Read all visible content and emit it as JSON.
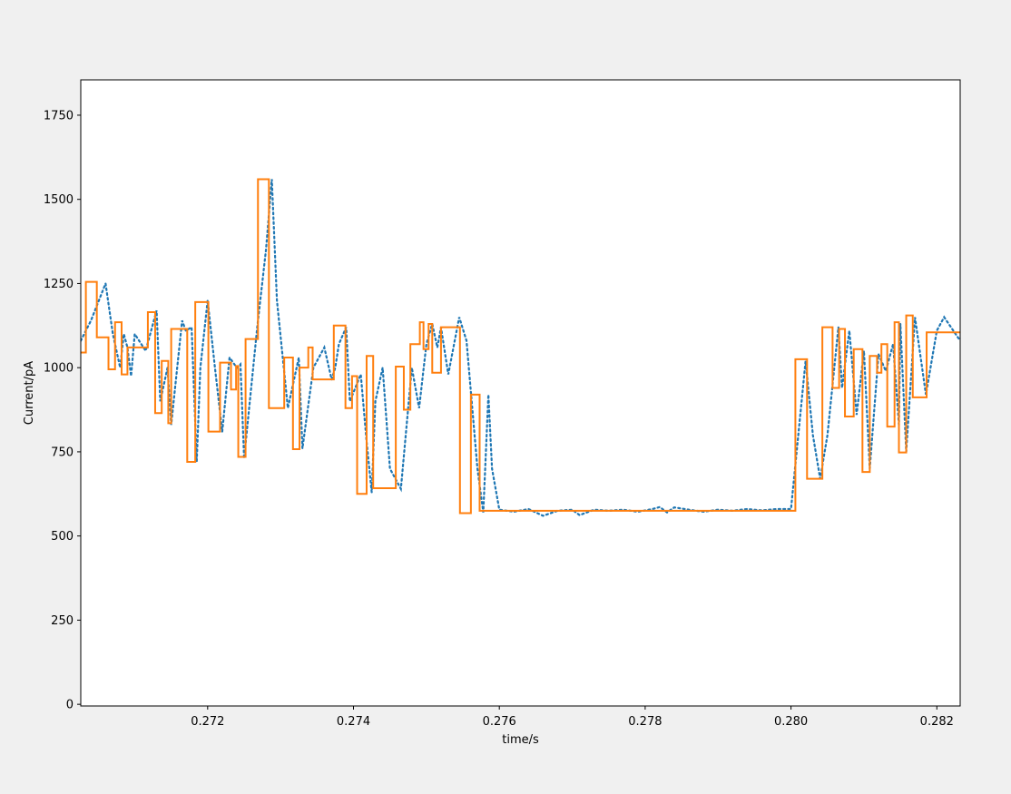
{
  "chart_data": {
    "type": "line",
    "title": "",
    "xlabel": "time/s",
    "ylabel": "Current/pA",
    "xlim": [
      0.27026,
      0.28232
    ],
    "ylim": [
      -5,
      1855
    ],
    "grid": false,
    "x_ticks": [
      {
        "value": 0.272,
        "label": "0.272"
      },
      {
        "value": 0.274,
        "label": "0.274"
      },
      {
        "value": 0.276,
        "label": "0.276"
      },
      {
        "value": 0.278,
        "label": "0.278"
      },
      {
        "value": 0.28,
        "label": "0.280"
      },
      {
        "value": 0.282,
        "label": "0.282"
      }
    ],
    "y_ticks": [
      {
        "value": 0,
        "label": "0"
      },
      {
        "value": 250,
        "label": "250"
      },
      {
        "value": 500,
        "label": "500"
      },
      {
        "value": 750,
        "label": "750"
      },
      {
        "value": 1000,
        "label": "1000"
      },
      {
        "value": 1250,
        "label": "1250"
      },
      {
        "value": 1500,
        "label": "1500"
      },
      {
        "value": 1750,
        "label": "1750"
      }
    ],
    "series": [
      {
        "style": "dotted",
        "color": "#1f77b4",
        "points": [
          [
            0.27026,
            1080
          ],
          [
            0.2704,
            1140
          ],
          [
            0.2706,
            1250
          ],
          [
            0.2707,
            1100
          ],
          [
            0.2708,
            1000
          ],
          [
            0.27085,
            1100
          ],
          [
            0.2709,
            1060
          ],
          [
            0.27095,
            975
          ],
          [
            0.271,
            1100
          ],
          [
            0.27115,
            1050
          ],
          [
            0.2713,
            1170
          ],
          [
            0.27135,
            900
          ],
          [
            0.27145,
            1000
          ],
          [
            0.2715,
            830
          ],
          [
            0.27165,
            1140
          ],
          [
            0.2717,
            1110
          ],
          [
            0.27178,
            1120
          ],
          [
            0.27185,
            720
          ],
          [
            0.2719,
            1000
          ],
          [
            0.272,
            1200
          ],
          [
            0.2721,
            1000
          ],
          [
            0.2722,
            810
          ],
          [
            0.2723,
            1030
          ],
          [
            0.2724,
            1000
          ],
          [
            0.27245,
            1010
          ],
          [
            0.2725,
            730
          ],
          [
            0.27268,
            1120
          ],
          [
            0.2728,
            1350
          ],
          [
            0.27288,
            1560
          ],
          [
            0.27295,
            1200
          ],
          [
            0.2731,
            880
          ],
          [
            0.27325,
            1030
          ],
          [
            0.2733,
            760
          ],
          [
            0.27345,
            1000
          ],
          [
            0.2736,
            1060
          ],
          [
            0.2737,
            965
          ],
          [
            0.27375,
            1000
          ],
          [
            0.2738,
            1070
          ],
          [
            0.2739,
            1120
          ],
          [
            0.27395,
            900
          ],
          [
            0.2741,
            980
          ],
          [
            0.27418,
            780
          ],
          [
            0.27425,
            630
          ],
          [
            0.2743,
            900
          ],
          [
            0.2744,
            1000
          ],
          [
            0.2745,
            700
          ],
          [
            0.27465,
            640
          ],
          [
            0.2748,
            1000
          ],
          [
            0.2749,
            880
          ],
          [
            0.275,
            1070
          ],
          [
            0.27508,
            1130
          ],
          [
            0.27515,
            1060
          ],
          [
            0.2752,
            1120
          ],
          [
            0.2753,
            980
          ],
          [
            0.27545,
            1150
          ],
          [
            0.27555,
            1080
          ],
          [
            0.2757,
            700
          ],
          [
            0.27578,
            570
          ],
          [
            0.27585,
            920
          ],
          [
            0.2759,
            700
          ],
          [
            0.276,
            578
          ],
          [
            0.2762,
            572
          ],
          [
            0.2764,
            580
          ],
          [
            0.2766,
            560
          ],
          [
            0.2768,
            575
          ],
          [
            0.277,
            578
          ],
          [
            0.2771,
            562
          ],
          [
            0.2773,
            578
          ],
          [
            0.2775,
            575
          ],
          [
            0.2777,
            578
          ],
          [
            0.2779,
            572
          ],
          [
            0.2781,
            580
          ],
          [
            0.2782,
            586
          ],
          [
            0.2783,
            570
          ],
          [
            0.2784,
            585
          ],
          [
            0.2786,
            578
          ],
          [
            0.2788,
            572
          ],
          [
            0.279,
            578
          ],
          [
            0.2792,
            575
          ],
          [
            0.2794,
            580
          ],
          [
            0.2796,
            576
          ],
          [
            0.2798,
            580
          ],
          [
            0.28,
            580
          ],
          [
            0.2801,
            800
          ],
          [
            0.2802,
            1020
          ],
          [
            0.2803,
            800
          ],
          [
            0.2804,
            670
          ],
          [
            0.2805,
            800
          ],
          [
            0.28065,
            1120
          ],
          [
            0.2807,
            940
          ],
          [
            0.2808,
            1110
          ],
          [
            0.2809,
            860
          ],
          [
            0.281,
            1050
          ],
          [
            0.28108,
            700
          ],
          [
            0.2812,
            1040
          ],
          [
            0.2813,
            990
          ],
          [
            0.2814,
            1070
          ],
          [
            0.28148,
            830
          ],
          [
            0.2815,
            1130
          ],
          [
            0.28158,
            750
          ],
          [
            0.2817,
            1150
          ],
          [
            0.28185,
            920
          ],
          [
            0.282,
            1110
          ],
          [
            0.2821,
            1150
          ],
          [
            0.28232,
            1080
          ]
        ]
      },
      {
        "style": "step",
        "color": "#ff7f0e",
        "points": [
          [
            0.27026,
            1045
          ],
          [
            0.27033,
            1045
          ],
          [
            0.27033,
            1255
          ],
          [
            0.27048,
            1255
          ],
          [
            0.27048,
            1090
          ],
          [
            0.27064,
            1090
          ],
          [
            0.27064,
            995
          ],
          [
            0.27073,
            995
          ],
          [
            0.27073,
            1135
          ],
          [
            0.27082,
            1135
          ],
          [
            0.27082,
            980
          ],
          [
            0.2709,
            980
          ],
          [
            0.2709,
            1060
          ],
          [
            0.27118,
            1060
          ],
          [
            0.27118,
            1165
          ],
          [
            0.27128,
            1165
          ],
          [
            0.27128,
            865
          ],
          [
            0.27137,
            865
          ],
          [
            0.27137,
            1020
          ],
          [
            0.27146,
            1020
          ],
          [
            0.27146,
            835
          ],
          [
            0.2715,
            835
          ],
          [
            0.2715,
            1115
          ],
          [
            0.27172,
            1115
          ],
          [
            0.27172,
            720
          ],
          [
            0.27183,
            720
          ],
          [
            0.27183,
            1195
          ],
          [
            0.27201,
            1195
          ],
          [
            0.27201,
            810
          ],
          [
            0.27217,
            810
          ],
          [
            0.27217,
            1015
          ],
          [
            0.27232,
            1015
          ],
          [
            0.27232,
            935
          ],
          [
            0.27239,
            935
          ],
          [
            0.27239,
            1005
          ],
          [
            0.27242,
            1005
          ],
          [
            0.27242,
            735
          ],
          [
            0.27252,
            735
          ],
          [
            0.27252,
            1085
          ],
          [
            0.27269,
            1085
          ],
          [
            0.27269,
            1560
          ],
          [
            0.27284,
            1560
          ],
          [
            0.27284,
            880
          ],
          [
            0.27305,
            880
          ],
          [
            0.27305,
            1030
          ],
          [
            0.27317,
            1030
          ],
          [
            0.27317,
            758
          ],
          [
            0.27326,
            758
          ],
          [
            0.27326,
            1000
          ],
          [
            0.27338,
            1000
          ],
          [
            0.27338,
            1060
          ],
          [
            0.27344,
            1060
          ],
          [
            0.27344,
            965
          ],
          [
            0.27373,
            965
          ],
          [
            0.27373,
            1125
          ],
          [
            0.27389,
            1125
          ],
          [
            0.27389,
            880
          ],
          [
            0.27398,
            880
          ],
          [
            0.27398,
            975
          ],
          [
            0.27405,
            975
          ],
          [
            0.27405,
            625
          ],
          [
            0.27418,
            625
          ],
          [
            0.27418,
            1035
          ],
          [
            0.27427,
            1035
          ],
          [
            0.27427,
            642
          ],
          [
            0.27458,
            642
          ],
          [
            0.27458,
            1003
          ],
          [
            0.27469,
            1003
          ],
          [
            0.27469,
            875
          ],
          [
            0.27478,
            875
          ],
          [
            0.27478,
            1070
          ],
          [
            0.27491,
            1070
          ],
          [
            0.27491,
            1135
          ],
          [
            0.27496,
            1135
          ],
          [
            0.27496,
            1055
          ],
          [
            0.27503,
            1055
          ],
          [
            0.27503,
            1130
          ],
          [
            0.27508,
            1130
          ],
          [
            0.27508,
            985
          ],
          [
            0.2752,
            985
          ],
          [
            0.2752,
            1120
          ],
          [
            0.27546,
            1120
          ],
          [
            0.27546,
            568
          ],
          [
            0.27561,
            568
          ],
          [
            0.27561,
            920
          ],
          [
            0.27573,
            920
          ],
          [
            0.27573,
            575
          ],
          [
            0.28006,
            575
          ],
          [
            0.28006,
            1025
          ],
          [
            0.28022,
            1025
          ],
          [
            0.28022,
            670
          ],
          [
            0.28043,
            670
          ],
          [
            0.28043,
            1120
          ],
          [
            0.28057,
            1120
          ],
          [
            0.28057,
            940
          ],
          [
            0.28066,
            940
          ],
          [
            0.28066,
            1115
          ],
          [
            0.28074,
            1115
          ],
          [
            0.28074,
            855
          ],
          [
            0.28086,
            855
          ],
          [
            0.28086,
            1055
          ],
          [
            0.28098,
            1055
          ],
          [
            0.28098,
            690
          ],
          [
            0.28108,
            690
          ],
          [
            0.28108,
            1035
          ],
          [
            0.28118,
            1035
          ],
          [
            0.28118,
            985
          ],
          [
            0.28124,
            985
          ],
          [
            0.28124,
            1070
          ],
          [
            0.28132,
            1070
          ],
          [
            0.28132,
            825
          ],
          [
            0.28142,
            825
          ],
          [
            0.28142,
            1135
          ],
          [
            0.28148,
            1135
          ],
          [
            0.28148,
            748
          ],
          [
            0.28158,
            748
          ],
          [
            0.28158,
            1155
          ],
          [
            0.28167,
            1155
          ],
          [
            0.28167,
            912
          ],
          [
            0.28186,
            912
          ],
          [
            0.28186,
            1105
          ],
          [
            0.28232,
            1105
          ]
        ]
      }
    ]
  }
}
